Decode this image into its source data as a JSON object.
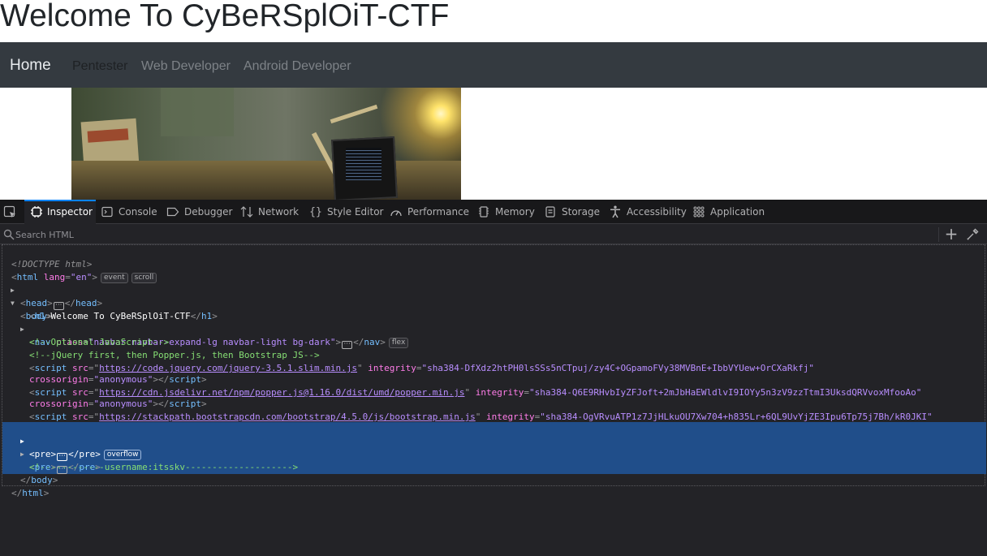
{
  "page": {
    "heading": "Welcome To CyBeRSplOiT-CTF",
    "navbar": {
      "brand": "Home",
      "links": [
        "Pentester",
        "Web Developer",
        "Android Developer"
      ]
    }
  },
  "devtools": {
    "tabs": [
      "Inspector",
      "Console",
      "Debugger",
      "Network",
      "Style Editor",
      "Performance",
      "Memory",
      "Storage",
      "Accessibility",
      "Application"
    ],
    "active_tab": "Inspector",
    "search_placeholder": "Search HTML",
    "markup": {
      "doctype": "<!DOCTYPE html>",
      "html_open_tag": "html",
      "html_attr_name": "lang",
      "html_attr_value": "\"en\"",
      "badge_event": "event",
      "badge_scroll": "scroll",
      "head_tag": "head",
      "body_tag": "body",
      "h1_tag": "h1",
      "h1_text": "Welcome To CyBeRSplOiT-CTF",
      "nav_tag": "nav",
      "nav_attr_name": "class",
      "nav_attr_value": "\"navbar navbar-expand-lg navbar-light bg-dark\"",
      "badge_flex": "flex",
      "comment1": "<!--Optional JavaScript-->",
      "comment2": "<!--jQuery first, then Popper.js, then Bootstrap JS-->",
      "scripts": [
        {
          "src": "https://code.jquery.com/jquery-3.5.1.slim.min.js",
          "integrity": "\"sha384-DfXdz2htPH0lsSSs5nCTpuj/zy4C+OGpamoFVy38MVBnE+IbbVYUew+OrCXaRkfj\""
        },
        {
          "src": "https://cdn.jsdelivr.net/npm/popper.js@1.16.0/dist/umd/popper.min.js",
          "integrity": "\"sha384-Q6E9RHvbIyZFJoft+2mJbHaEWldlvI9IOYy5n3zV9zzTtmI3UksdQRVvoxMfooAo\""
        },
        {
          "src": "https://stackpath.bootstrapcdn.com/bootstrap/4.5.0/js/bootstrap.min.js",
          "integrity": "\"sha384-OgVRvuATP1z7JjHLkuOU7Xw704+h835Lr+6QL9UvYjZE3Ipu6Tp75j7Bh/kR0JKI\""
        }
      ],
      "script_tag": "script",
      "src_attr": "src",
      "integrity_attr": "integrity",
      "crossorigin_attr": "crossorigin",
      "crossorigin_value": "\"anonymous\"",
      "pre_tag": "pre",
      "badge_overflow": "overflow",
      "comment3": "<!------------username:itsskv-------------------->"
    }
  }
}
